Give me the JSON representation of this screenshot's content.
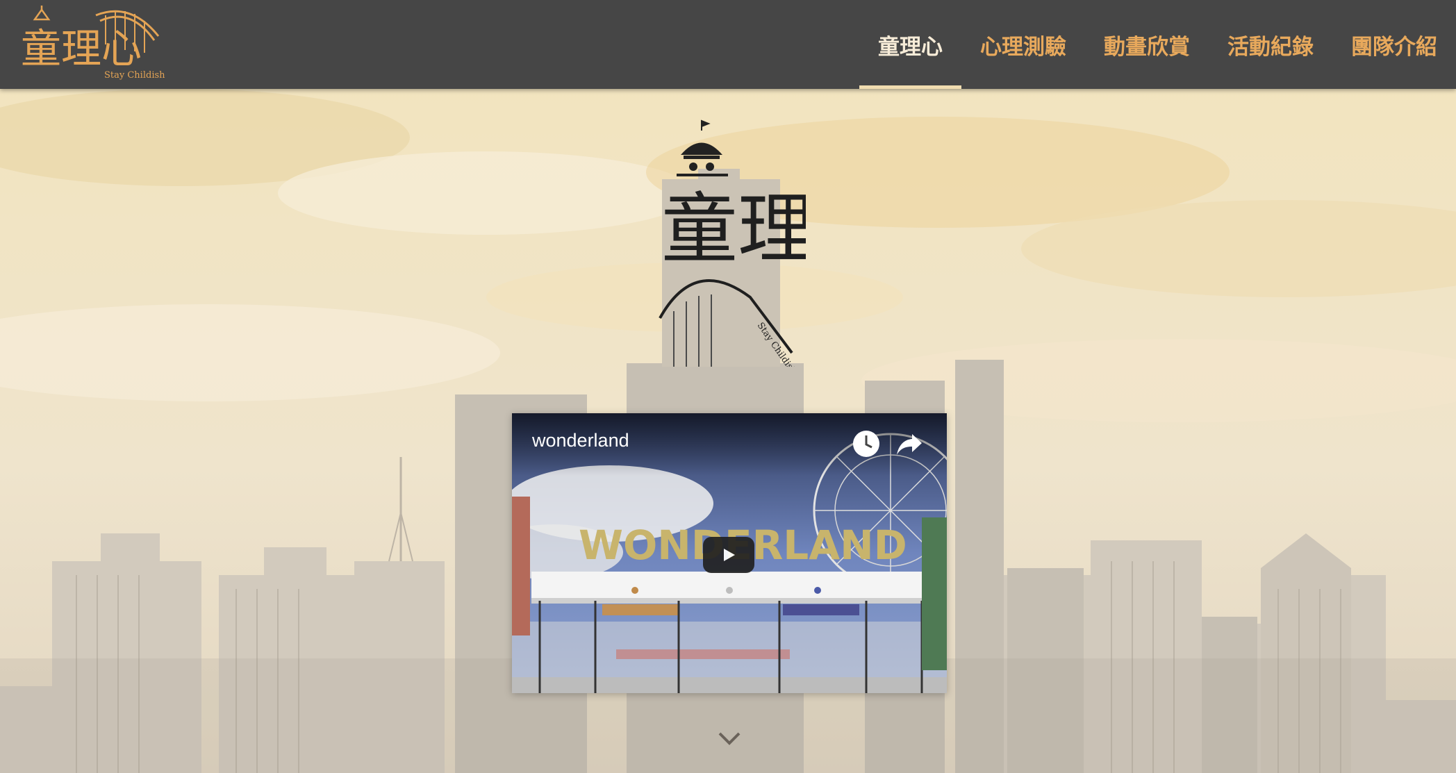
{
  "brand": {
    "logo_text": "童理心",
    "tagline": "Stay Childish"
  },
  "nav": {
    "items": [
      {
        "label": "童理心",
        "active": true
      },
      {
        "label": "心理測驗",
        "active": false
      },
      {
        "label": "動畫欣賞",
        "active": false
      },
      {
        "label": "活動紀錄",
        "active": false
      },
      {
        "label": "團隊介紹",
        "active": false
      }
    ]
  },
  "hero": {
    "logo_text": "童理心",
    "tagline": "Stay Childish"
  },
  "video": {
    "title": "wonderland",
    "thumbnail_sign": "WONDERLAND",
    "icons": [
      "clock-icon",
      "share-icon",
      "play-icon"
    ]
  },
  "colors": {
    "nav_bg": "#464646",
    "nav_link": "#e8a95c",
    "nav_active": "#f7ecd8",
    "sky": "#efe2c4",
    "building": "#c9c2b6"
  }
}
